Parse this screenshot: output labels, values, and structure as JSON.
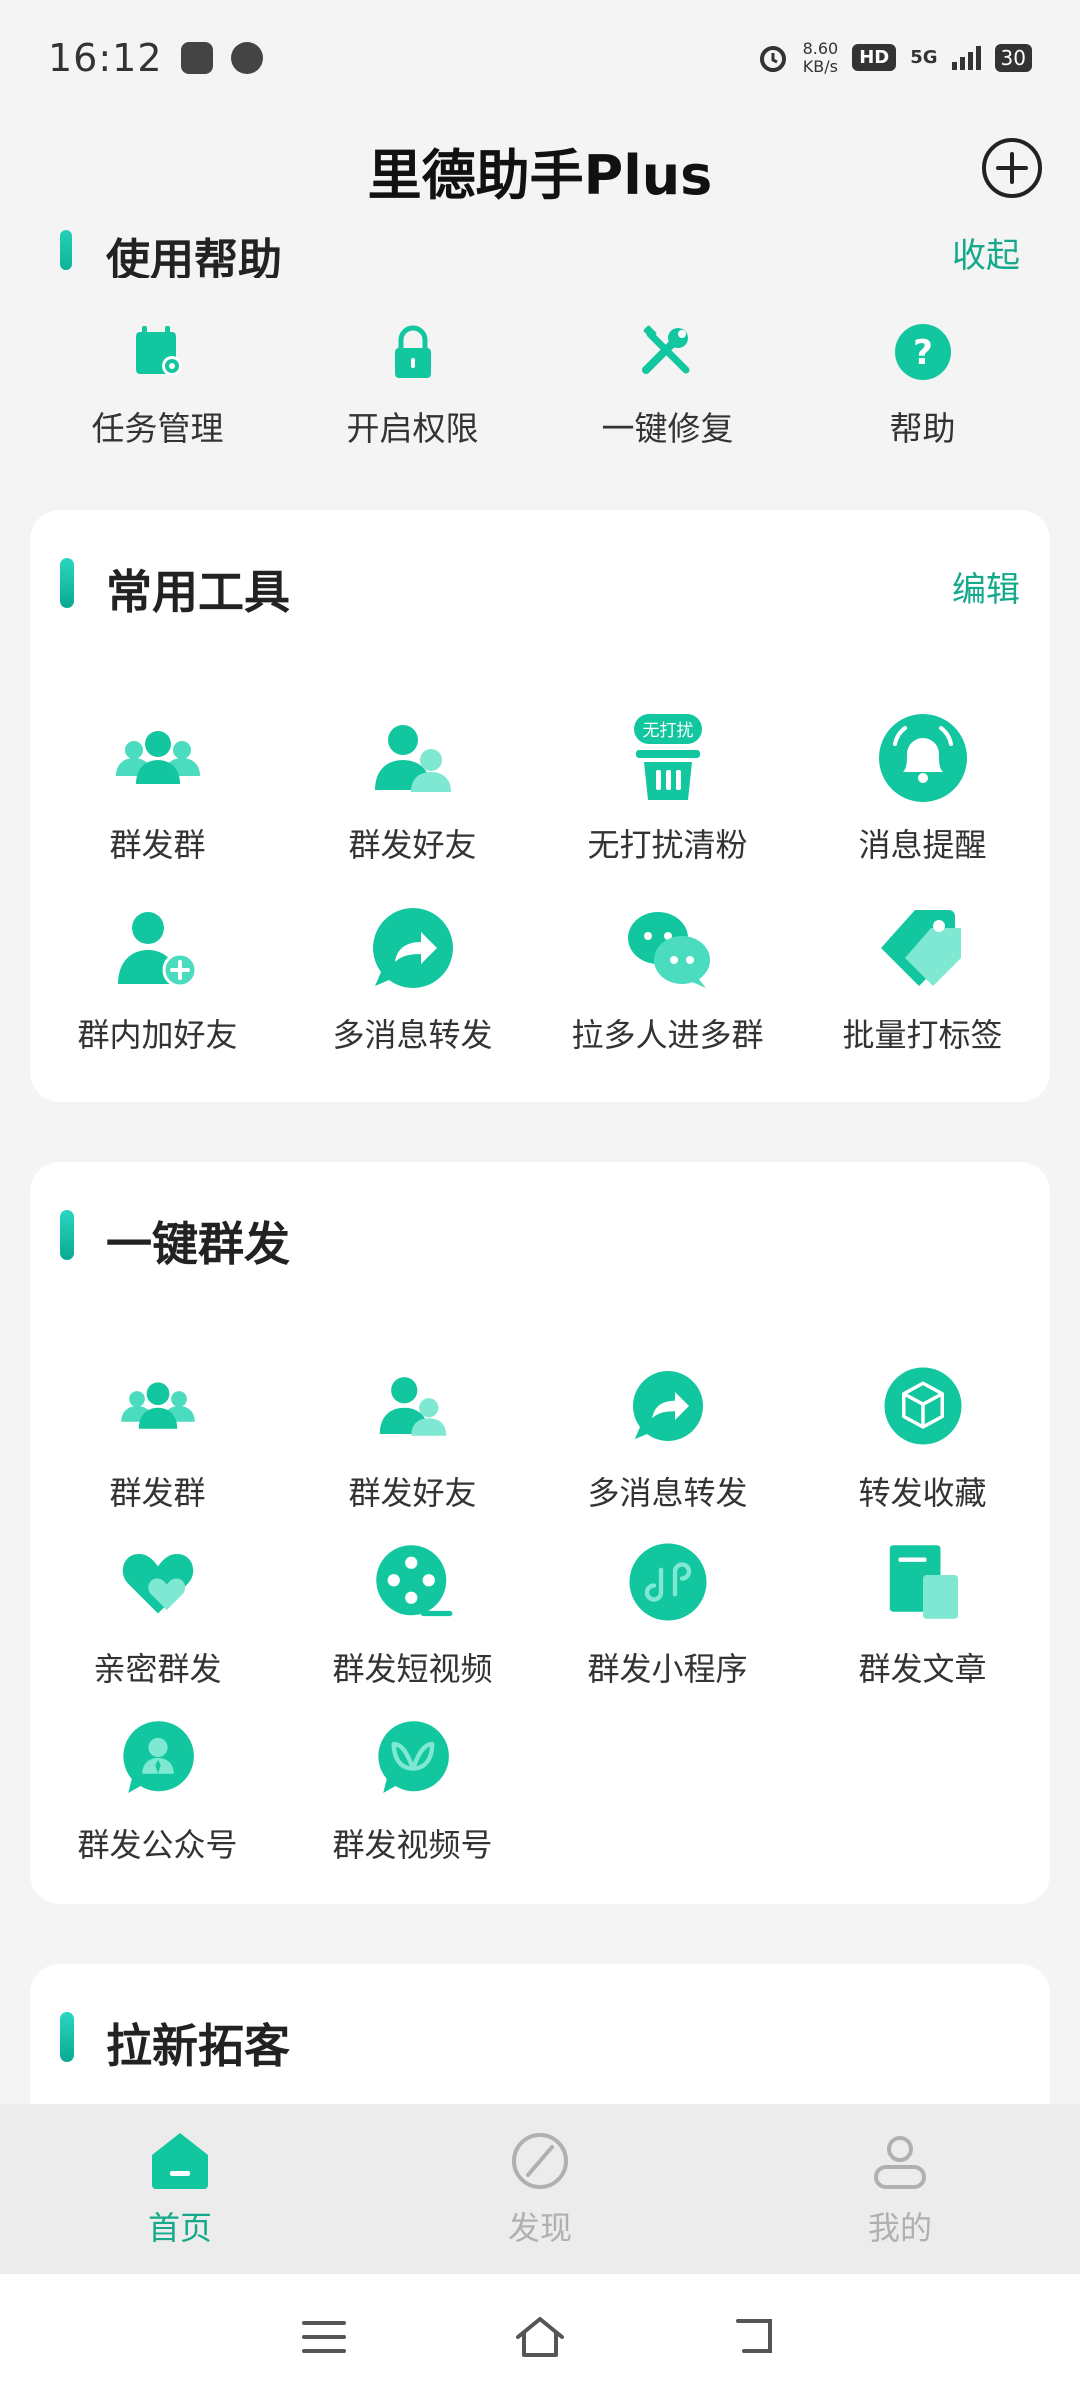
{
  "status_bar": {
    "time": "16:12",
    "net_speed_value": "8.60",
    "net_speed_unit": "KB/s",
    "hd_label": "HD",
    "signal_label": "5G",
    "battery": "30"
  },
  "header": {
    "title": "里德助手Plus",
    "add_icon": "plus-circle-icon"
  },
  "help_section": {
    "title": "使用帮助",
    "collapse_label": "收起",
    "items": [
      {
        "label": "任务管理",
        "icon": "calendar-gear-icon"
      },
      {
        "label": "开启权限",
        "icon": "lock-icon"
      },
      {
        "label": "一键修复",
        "icon": "tools-icon"
      },
      {
        "label": "帮助",
        "icon": "question-icon"
      }
    ]
  },
  "common_tools": {
    "title": "常用工具",
    "edit_label": "编辑",
    "items": [
      {
        "label": "群发群",
        "icon": "group-icon"
      },
      {
        "label": "群发好友",
        "icon": "friends-icon"
      },
      {
        "label": "无打扰清粉",
        "icon": "trash-icon",
        "badge": "无打扰"
      },
      {
        "label": "消息提醒",
        "icon": "bell-icon"
      },
      {
        "label": "群内加好友",
        "icon": "add-friend-icon"
      },
      {
        "label": "多消息转发",
        "icon": "forward-icon"
      },
      {
        "label": "拉多人进多群",
        "icon": "chat-bubbles-icon"
      },
      {
        "label": "批量打标签",
        "icon": "tag-icon"
      }
    ]
  },
  "mass_send": {
    "title": "一键群发",
    "items": [
      {
        "label": "群发群",
        "icon": "group-icon"
      },
      {
        "label": "群发好友",
        "icon": "friends-icon"
      },
      {
        "label": "多消息转发",
        "icon": "forward-icon"
      },
      {
        "label": "转发收藏",
        "icon": "cube-icon"
      },
      {
        "label": "亲密群发",
        "icon": "heart-icon"
      },
      {
        "label": "群发短视频",
        "icon": "film-reel-icon"
      },
      {
        "label": "群发小程序",
        "icon": "mini-program-icon"
      },
      {
        "label": "群发文章",
        "icon": "article-icon"
      },
      {
        "label": "群发公众号",
        "icon": "official-account-icon"
      },
      {
        "label": "群发视频号",
        "icon": "channels-icon"
      }
    ]
  },
  "grow_section": {
    "title": "拉新拓客"
  },
  "bottom_nav": {
    "items": [
      {
        "label": "首页",
        "icon": "home-icon",
        "active": true
      },
      {
        "label": "发现",
        "icon": "compass-icon",
        "active": false
      },
      {
        "label": "我的",
        "icon": "profile-icon",
        "active": false
      }
    ]
  },
  "colors": {
    "accent": "#14a98a",
    "icon_green": "#12c79f",
    "background": "#f4f4f4"
  }
}
